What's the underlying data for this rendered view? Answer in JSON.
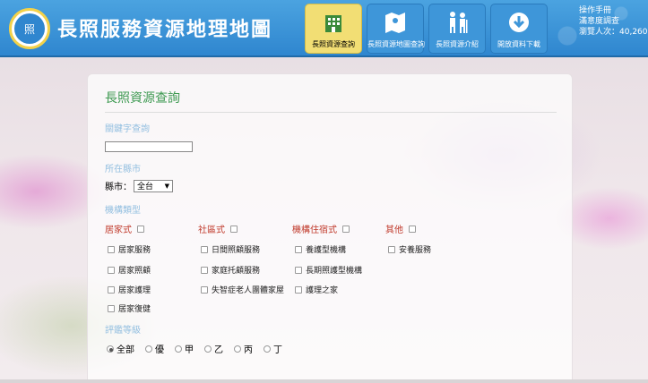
{
  "header": {
    "title": "長照服務資源地理地圖",
    "logo_text": "照",
    "nav": [
      {
        "label": "長照資源查詢",
        "icon": "building-icon",
        "active": true
      },
      {
        "label": "長照資源地圖查詢",
        "icon": "map-icon",
        "active": false
      },
      {
        "label": "長照資源介紹",
        "icon": "people-icon",
        "active": false
      },
      {
        "label": "開放資料下載",
        "icon": "download-icon",
        "active": false
      }
    ],
    "links": [
      "操作手冊",
      "滿意度調查",
      "瀏覽人次：40,260"
    ]
  },
  "panel": {
    "title": "長照資源查詢",
    "keyword_label": "關鍵字查詢",
    "keyword_value": "",
    "county_label": "所在縣市",
    "county_field_label": "縣市：",
    "county_selected": "全台",
    "type_label": "機構類型",
    "categories": [
      {
        "name": "居家式",
        "items": [
          "居家服務",
          "居家照顧",
          "居家護理",
          "居家復健"
        ]
      },
      {
        "name": "社區式",
        "items": [
          "日間照顧服務",
          "家庭托顧服務",
          "失智症老人團體家屋"
        ]
      },
      {
        "name": "機構住宿式",
        "items": [
          "養護型機構",
          "長期照護型機構",
          "護理之家"
        ]
      },
      {
        "name": "其他",
        "items": [
          "安養服務"
        ]
      }
    ],
    "rating_label": "評鑑等級",
    "ratings": [
      "全部",
      "優",
      "甲",
      "乙",
      "丙",
      "丁"
    ],
    "rating_selected": "全部"
  }
}
